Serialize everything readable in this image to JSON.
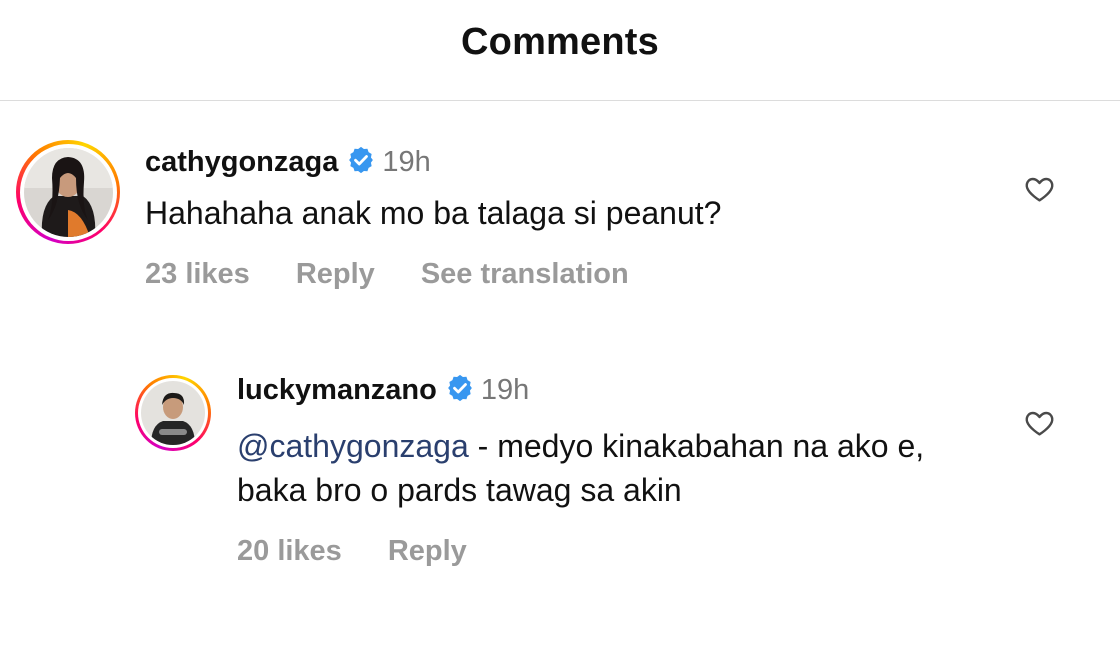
{
  "header": {
    "title": "Comments"
  },
  "comments": [
    {
      "username": "cathygonzaga",
      "verified": true,
      "time": "19h",
      "text": "Hahahaha anak mo ba talaga si peanut?",
      "likes": "23 likes",
      "reply_label": "Reply",
      "translate_label": "See translation"
    },
    {
      "username": "luckymanzano",
      "verified": true,
      "time": "19h",
      "mention": "@cathygonzaga",
      "text": " - medyo kinakabahan na ako e, baka bro o pards tawag sa akin",
      "likes": "20 likes",
      "reply_label": "Reply"
    }
  ],
  "colors": {
    "verified_badge": "#3897f0",
    "mention": "#2a3f6e",
    "meta_text": "#9a9a9a",
    "timestamp": "#777777"
  },
  "icons": [
    "verified-badge-icon",
    "heart-icon"
  ]
}
